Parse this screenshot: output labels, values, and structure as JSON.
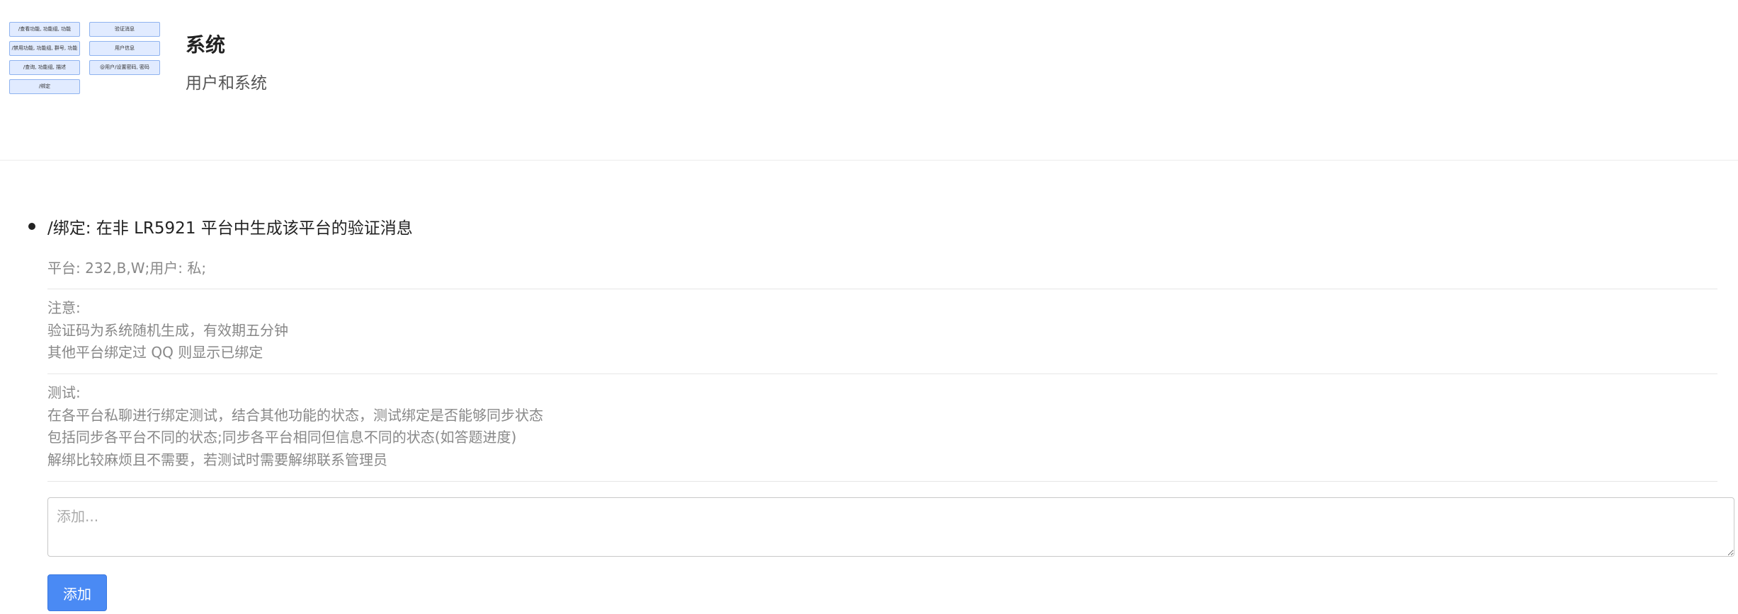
{
  "header": {
    "title": "系统",
    "subtitle": "用户和系统",
    "tags": [
      "/查看功能, 功能组, 功能",
      "验证消息",
      "/禁用功能, 功能组, 群号, 功能",
      "用户信息",
      "/查询, 功能组, 描述",
      "@用户/设置密码, 密码",
      "/绑定"
    ]
  },
  "item": {
    "title": "/绑定: 在非 LR5921 平台中生成该平台的验证消息",
    "platform": "平台: 232,B,W;用户: 私;",
    "notes": [
      "注意:",
      "验证码为系统随机生成，有效期五分钟",
      "其他平台绑定过 QQ 则显示已绑定"
    ],
    "tests": [
      "测试:",
      "在各平台私聊进行绑定测试，结合其他功能的状态，测试绑定是否能够同步状态",
      "包括同步各平台不同的状态;同步各平台相同但信息不同的状态(如答题进度)",
      "解绑比较麻烦且不需要，若测试时需要解绑联系管理员"
    ]
  },
  "form": {
    "placeholder": "添加...",
    "value": "",
    "add_label": "添加"
  },
  "colors": {
    "accent": "#4a8af4",
    "tag_bg": "#e1ebff",
    "tag_border": "#8fb3ef",
    "muted_text": "#888888"
  }
}
